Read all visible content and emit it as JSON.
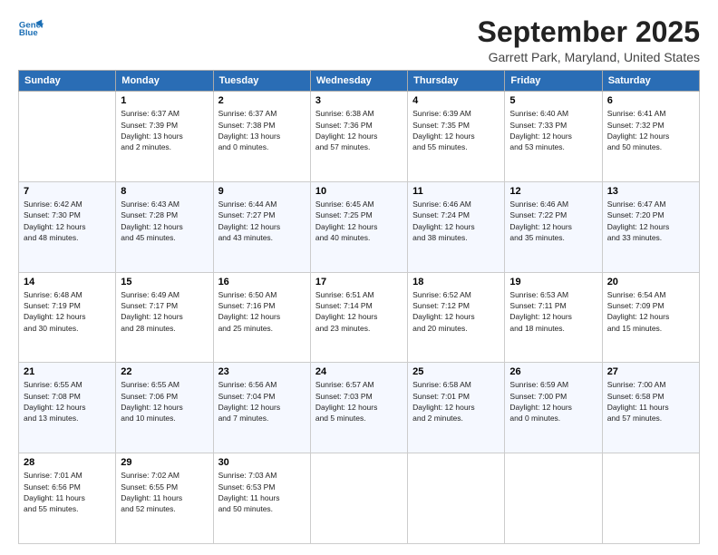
{
  "logo": {
    "line1": "General",
    "line2": "Blue"
  },
  "title": "September 2025",
  "location": "Garrett Park, Maryland, United States",
  "days_of_week": [
    "Sunday",
    "Monday",
    "Tuesday",
    "Wednesday",
    "Thursday",
    "Friday",
    "Saturday"
  ],
  "weeks": [
    [
      {
        "day": "",
        "info": ""
      },
      {
        "day": "1",
        "info": "Sunrise: 6:37 AM\nSunset: 7:39 PM\nDaylight: 13 hours\nand 2 minutes."
      },
      {
        "day": "2",
        "info": "Sunrise: 6:37 AM\nSunset: 7:38 PM\nDaylight: 13 hours\nand 0 minutes."
      },
      {
        "day": "3",
        "info": "Sunrise: 6:38 AM\nSunset: 7:36 PM\nDaylight: 12 hours\nand 57 minutes."
      },
      {
        "day": "4",
        "info": "Sunrise: 6:39 AM\nSunset: 7:35 PM\nDaylight: 12 hours\nand 55 minutes."
      },
      {
        "day": "5",
        "info": "Sunrise: 6:40 AM\nSunset: 7:33 PM\nDaylight: 12 hours\nand 53 minutes."
      },
      {
        "day": "6",
        "info": "Sunrise: 6:41 AM\nSunset: 7:32 PM\nDaylight: 12 hours\nand 50 minutes."
      }
    ],
    [
      {
        "day": "7",
        "info": "Sunrise: 6:42 AM\nSunset: 7:30 PM\nDaylight: 12 hours\nand 48 minutes."
      },
      {
        "day": "8",
        "info": "Sunrise: 6:43 AM\nSunset: 7:28 PM\nDaylight: 12 hours\nand 45 minutes."
      },
      {
        "day": "9",
        "info": "Sunrise: 6:44 AM\nSunset: 7:27 PM\nDaylight: 12 hours\nand 43 minutes."
      },
      {
        "day": "10",
        "info": "Sunrise: 6:45 AM\nSunset: 7:25 PM\nDaylight: 12 hours\nand 40 minutes."
      },
      {
        "day": "11",
        "info": "Sunrise: 6:46 AM\nSunset: 7:24 PM\nDaylight: 12 hours\nand 38 minutes."
      },
      {
        "day": "12",
        "info": "Sunrise: 6:46 AM\nSunset: 7:22 PM\nDaylight: 12 hours\nand 35 minutes."
      },
      {
        "day": "13",
        "info": "Sunrise: 6:47 AM\nSunset: 7:20 PM\nDaylight: 12 hours\nand 33 minutes."
      }
    ],
    [
      {
        "day": "14",
        "info": "Sunrise: 6:48 AM\nSunset: 7:19 PM\nDaylight: 12 hours\nand 30 minutes."
      },
      {
        "day": "15",
        "info": "Sunrise: 6:49 AM\nSunset: 7:17 PM\nDaylight: 12 hours\nand 28 minutes."
      },
      {
        "day": "16",
        "info": "Sunrise: 6:50 AM\nSunset: 7:16 PM\nDaylight: 12 hours\nand 25 minutes."
      },
      {
        "day": "17",
        "info": "Sunrise: 6:51 AM\nSunset: 7:14 PM\nDaylight: 12 hours\nand 23 minutes."
      },
      {
        "day": "18",
        "info": "Sunrise: 6:52 AM\nSunset: 7:12 PM\nDaylight: 12 hours\nand 20 minutes."
      },
      {
        "day": "19",
        "info": "Sunrise: 6:53 AM\nSunset: 7:11 PM\nDaylight: 12 hours\nand 18 minutes."
      },
      {
        "day": "20",
        "info": "Sunrise: 6:54 AM\nSunset: 7:09 PM\nDaylight: 12 hours\nand 15 minutes."
      }
    ],
    [
      {
        "day": "21",
        "info": "Sunrise: 6:55 AM\nSunset: 7:08 PM\nDaylight: 12 hours\nand 13 minutes."
      },
      {
        "day": "22",
        "info": "Sunrise: 6:55 AM\nSunset: 7:06 PM\nDaylight: 12 hours\nand 10 minutes."
      },
      {
        "day": "23",
        "info": "Sunrise: 6:56 AM\nSunset: 7:04 PM\nDaylight: 12 hours\nand 7 minutes."
      },
      {
        "day": "24",
        "info": "Sunrise: 6:57 AM\nSunset: 7:03 PM\nDaylight: 12 hours\nand 5 minutes."
      },
      {
        "day": "25",
        "info": "Sunrise: 6:58 AM\nSunset: 7:01 PM\nDaylight: 12 hours\nand 2 minutes."
      },
      {
        "day": "26",
        "info": "Sunrise: 6:59 AM\nSunset: 7:00 PM\nDaylight: 12 hours\nand 0 minutes."
      },
      {
        "day": "27",
        "info": "Sunrise: 7:00 AM\nSunset: 6:58 PM\nDaylight: 11 hours\nand 57 minutes."
      }
    ],
    [
      {
        "day": "28",
        "info": "Sunrise: 7:01 AM\nSunset: 6:56 PM\nDaylight: 11 hours\nand 55 minutes."
      },
      {
        "day": "29",
        "info": "Sunrise: 7:02 AM\nSunset: 6:55 PM\nDaylight: 11 hours\nand 52 minutes."
      },
      {
        "day": "30",
        "info": "Sunrise: 7:03 AM\nSunset: 6:53 PM\nDaylight: 11 hours\nand 50 minutes."
      },
      {
        "day": "",
        "info": ""
      },
      {
        "day": "",
        "info": ""
      },
      {
        "day": "",
        "info": ""
      },
      {
        "day": "",
        "info": ""
      }
    ]
  ]
}
